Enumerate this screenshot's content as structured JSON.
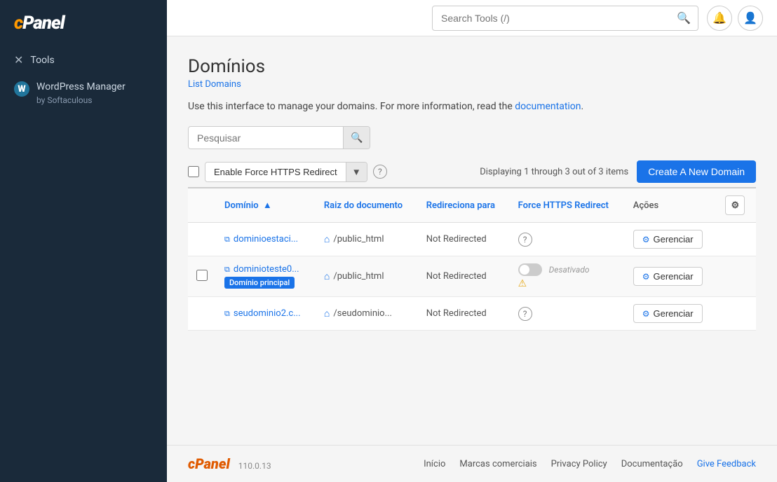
{
  "sidebar": {
    "logo_text": "cPanel",
    "items": [
      {
        "id": "tools",
        "label": "Tools",
        "icon": "✕"
      },
      {
        "id": "wordpress-manager",
        "label": "WordPress Manager",
        "sublabel": "by Softaculous"
      }
    ]
  },
  "topbar": {
    "search_placeholder": "Search Tools (/)"
  },
  "page": {
    "title": "Domínios",
    "breadcrumb": "List Domains",
    "description_before_link": "Use this interface to manage your domains. For more information, read the ",
    "description_link_text": "documentation",
    "description_after_link": ".",
    "search_placeholder": "Pesquisar",
    "display_count": "Displaying 1 through 3 out of 3 items",
    "enable_https_label": "Enable Force HTTPS Redirect",
    "create_btn_label": "Create A New Domain"
  },
  "table": {
    "columns": [
      {
        "id": "domain",
        "label": "Domínio",
        "sortable": true
      },
      {
        "id": "doc_root",
        "label": "Raiz do documento",
        "sortable": false
      },
      {
        "id": "redirect",
        "label": "Redireciona para",
        "sortable": false
      },
      {
        "id": "force_https",
        "label": "Force HTTPS Redirect",
        "sortable": false
      },
      {
        "id": "actions",
        "label": "Ações",
        "sortable": false
      }
    ],
    "rows": [
      {
        "id": "row1",
        "domain": "dominioestaci...",
        "doc_root": "/public_html",
        "redirect": "Not Redirected",
        "force_https_toggle": false,
        "force_https_text": "",
        "has_warning": false,
        "badge": null,
        "manage_label": "Gerenciar"
      },
      {
        "id": "row2",
        "domain": "dominioteste0...",
        "doc_root": "/public_html",
        "redirect": "Not Redirected",
        "force_https_toggle": false,
        "force_https_text": "Desativado",
        "has_warning": true,
        "badge": "Domínio principal",
        "manage_label": "Gerenciar"
      },
      {
        "id": "row3",
        "domain": "seudominio2.c...",
        "doc_root": "/seudominio...",
        "redirect": "Not Redirected",
        "force_https_toggle": false,
        "force_https_text": "",
        "has_warning": false,
        "badge": null,
        "manage_label": "Gerenciar"
      }
    ]
  },
  "footer": {
    "logo": "cPanel",
    "version": "110.0.13",
    "links": [
      {
        "id": "inicio",
        "label": "Início"
      },
      {
        "id": "marcas",
        "label": "Marcas comerciais"
      },
      {
        "id": "privacy",
        "label": "Privacy Policy"
      },
      {
        "id": "docs",
        "label": "Documentação"
      },
      {
        "id": "feedback",
        "label": "Give Feedback"
      }
    ]
  }
}
